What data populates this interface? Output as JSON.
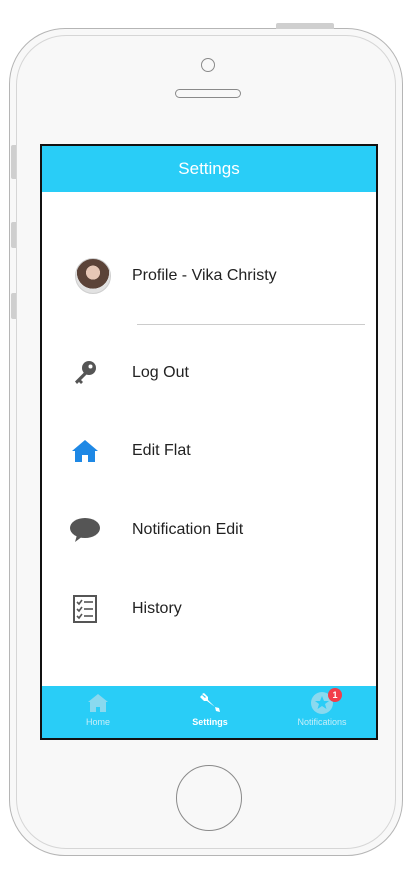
{
  "header": {
    "title": "Settings"
  },
  "profile": {
    "label": "Profile - Vika Christy"
  },
  "menu": {
    "logout": "Log Out",
    "edit_flat": "Edit Flat",
    "notification_edit": "Notification Edit",
    "history": "History"
  },
  "tabs": [
    {
      "label": "Home",
      "icon": "home-icon"
    },
    {
      "label": "Settings",
      "icon": "wrench-icon",
      "active": true
    },
    {
      "label": "Notifications",
      "icon": "star-badge-icon",
      "badge": "1"
    }
  ],
  "colors": {
    "accent": "#29cdf7",
    "badge": "#f23d4a",
    "home_icon": "#1e88e5"
  }
}
